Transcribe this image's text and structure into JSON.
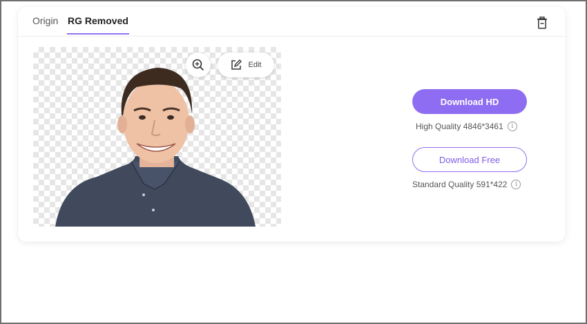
{
  "tabs": [
    {
      "label": "Origin",
      "active": false
    },
    {
      "label": "RG Removed",
      "active": true
    }
  ],
  "toolbar": {
    "delete_icon": "trash-icon",
    "zoom_icon": "zoom-in-icon",
    "edit_label": "Edit",
    "edit_icon": "edit-icon"
  },
  "downloads": {
    "hd": {
      "label": "Download HD",
      "quality": "High Quality 4846*3461"
    },
    "free": {
      "label": "Download Free",
      "quality": "Standard Quality 591*422"
    }
  },
  "colors": {
    "accent": "#8f6df2",
    "tab_underline": "#8f72f0"
  }
}
